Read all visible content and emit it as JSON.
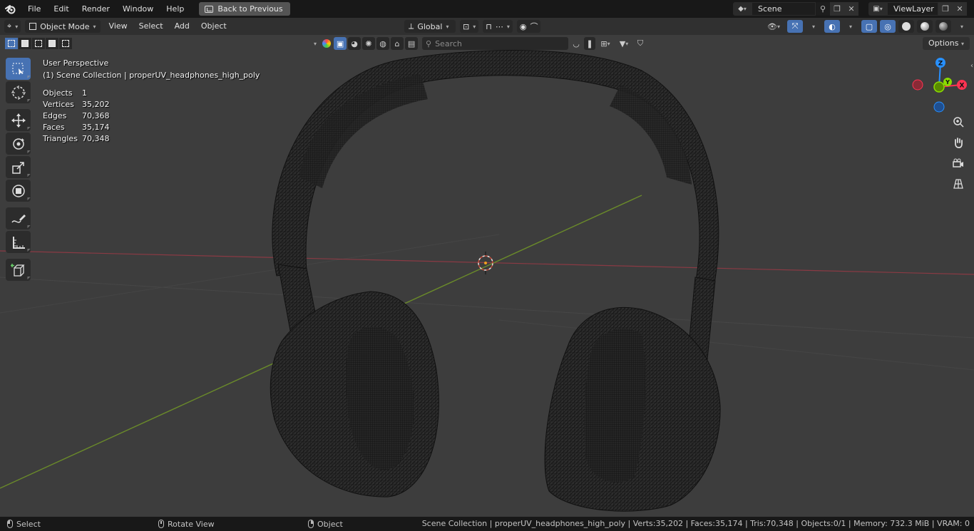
{
  "topbar": {
    "menus": [
      "File",
      "Edit",
      "Render",
      "Window",
      "Help"
    ],
    "back_label": "Back to Previous",
    "scene": "Scene",
    "view_layer": "ViewLayer"
  },
  "header": {
    "mode": "Object Mode",
    "menus": [
      "View",
      "Select",
      "Add",
      "Object"
    ],
    "transform_orientation": "Global"
  },
  "viewport_header": {
    "search_placeholder": "Search",
    "options_label": "Options"
  },
  "stats": {
    "view_name": "User Perspective",
    "collection_line": "(1) Scene Collection | properUV_headphones_high_poly",
    "rows": [
      {
        "label": "Objects",
        "value": "1"
      },
      {
        "label": "Vertices",
        "value": "35,202"
      },
      {
        "label": "Edges",
        "value": "70,368"
      },
      {
        "label": "Faces",
        "value": "35,174"
      },
      {
        "label": "Triangles",
        "value": "70,348"
      }
    ]
  },
  "gizmo": {
    "x_label": "X",
    "y_label": "Y",
    "z_label": "Z",
    "colors": {
      "x": "#ff3352",
      "y": "#8bdc00",
      "z": "#2890ff"
    }
  },
  "statusbar": {
    "select": "Select",
    "rotate": "Rotate View",
    "object": "Object",
    "info": "Scene Collection | properUV_headphones_high_poly | Verts:35,202 | Faces:35,174 | Tris:70,348 | Objects:0/1 | Memory: 732.3 MiB | VRAM: 0"
  },
  "icons": [
    "blender-logo-icon",
    "select-box-icon",
    "cursor-icon",
    "move-icon",
    "rotate-icon",
    "scale-icon",
    "transform-icon",
    "annotate-icon",
    "measure-icon",
    "add-cube-icon",
    "zoom-icon",
    "hand-icon",
    "camera-icon",
    "grid-icon"
  ]
}
